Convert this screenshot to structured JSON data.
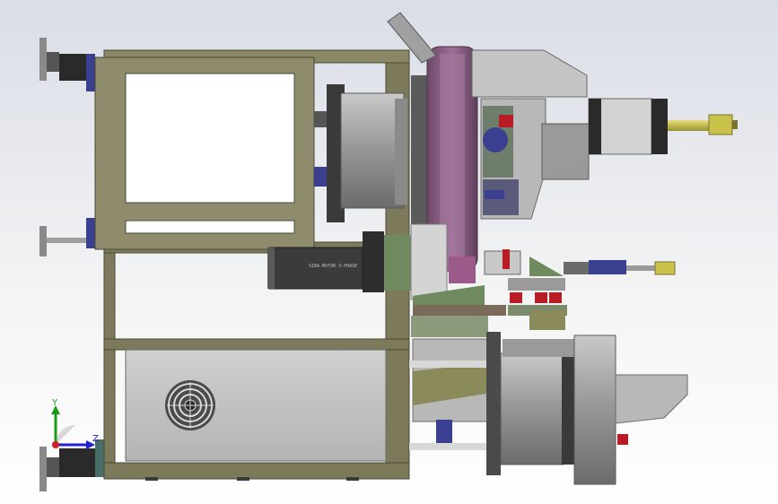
{
  "viewport": {
    "name": "cad-model-viewport",
    "background_top": "#d9dde6",
    "background_bottom": "#ffffff"
  },
  "model": {
    "frame_color": "#7d7a5c",
    "panel_color": "#c2c2c2",
    "flange_color": "#8c5f86",
    "motor_color": "#3b3b3b",
    "cylinder_color": "#a9a9a9",
    "accent_red": "#b81c24",
    "accent_blue": "#3a3f8f",
    "accent_green": "#6e8a5e",
    "rod_yellow": "#c9c24a"
  },
  "motor_label": "SIBA-MOTOR 3-PHASE",
  "triad": {
    "x_label": "Z",
    "y_label": "Y",
    "x_color": "#2020d0",
    "y_color": "#1a9a1a",
    "z_color": "#d02020"
  }
}
